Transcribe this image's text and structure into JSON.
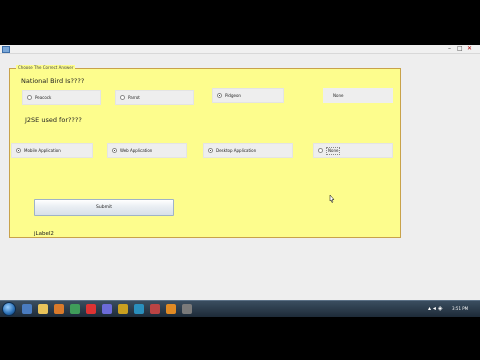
{
  "window": {
    "panel_title": "Choose The Correct Answer"
  },
  "questions": [
    {
      "text": "National Bird Is????",
      "options": [
        {
          "label": "Peacock",
          "checked": false
        },
        {
          "label": "Parrot",
          "checked": false
        },
        {
          "label": "Pidgeon",
          "checked": true
        },
        {
          "label": "None",
          "checked": false
        }
      ]
    },
    {
      "text": "J2SE used for????",
      "options": [
        {
          "label": "Mobile Application",
          "checked": true
        },
        {
          "label": "Web Application",
          "checked": true
        },
        {
          "label": "Desktop Application",
          "checked": true
        },
        {
          "label": "None",
          "checked": false
        }
      ]
    }
  ],
  "submit_label": "Submit",
  "result_label": "jLabel2",
  "taskbar": {
    "clock": "3:51 PM"
  },
  "colors": {
    "panel_bg": "#fdfd8d",
    "panel_border": "#c8a24a",
    "window_bg": "#eeeeee"
  }
}
